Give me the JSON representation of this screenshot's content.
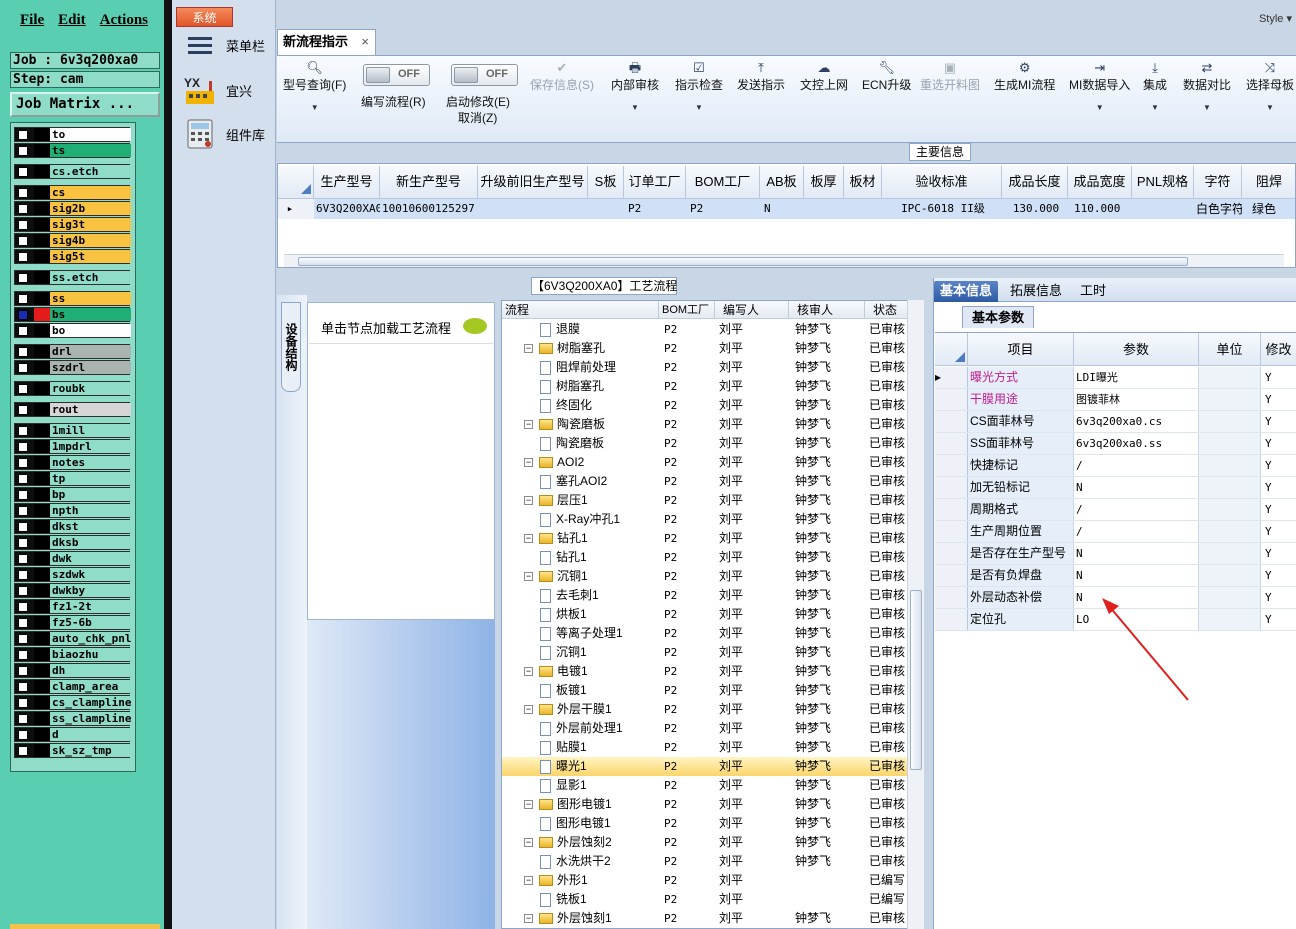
{
  "cam": {
    "menu": [
      "File",
      "Edit",
      "Actions"
    ],
    "job_line": "Job : 6v3q200xa0",
    "step_line": "Step: cam",
    "matrix_button": "Job Matrix ...",
    "layers": [
      {
        "name": "to",
        "color": "#ffffff"
      },
      {
        "name": "ts",
        "color": "#1fae73"
      },
      {
        "name": "cs.etch",
        "color": "#8fdcc8"
      },
      {
        "name": "cs",
        "color": "#f9c342"
      },
      {
        "name": "sig2b",
        "color": "#f9c342"
      },
      {
        "name": "sig3t",
        "color": "#f9c342"
      },
      {
        "name": "sig4b",
        "color": "#f9c342"
      },
      {
        "name": "sig5t",
        "color": "#f9c342"
      },
      {
        "name": "ss.etch",
        "color": "#8fdcc8"
      },
      {
        "name": "ss",
        "color": "#f9c342"
      },
      {
        "name": "bs",
        "color": "#1fae73"
      },
      {
        "name": "bo",
        "color": "#ffffff"
      },
      {
        "name": "drl",
        "color": "#a9b4b0"
      },
      {
        "name": "szdrl",
        "color": "#a9b4b0"
      },
      {
        "name": "roubk",
        "color": "#8fdcc8"
      },
      {
        "name": "rout",
        "color": "#d6d6d6"
      },
      {
        "name": "1mill",
        "color": "#8fdcc8"
      },
      {
        "name": "1mpdrl",
        "color": "#8fdcc8"
      },
      {
        "name": "notes",
        "color": "#8fdcc8"
      },
      {
        "name": "tp",
        "color": "#8fdcc8"
      },
      {
        "name": "bp",
        "color": "#8fdcc8"
      },
      {
        "name": "npth",
        "color": "#8fdcc8"
      },
      {
        "name": "dkst",
        "color": "#8fdcc8"
      },
      {
        "name": "dksb",
        "color": "#8fdcc8"
      },
      {
        "name": "dwk",
        "color": "#8fdcc8"
      },
      {
        "name": "szdwk",
        "color": "#8fdcc8"
      },
      {
        "name": "dwkby",
        "color": "#8fdcc8"
      },
      {
        "name": "fz1-2t",
        "color": "#8fdcc8"
      },
      {
        "name": "fz5-6b",
        "color": "#8fdcc8"
      },
      {
        "name": "auto_chk_pnl",
        "color": "#8fdcc8"
      },
      {
        "name": "biaozhu",
        "color": "#8fdcc8"
      },
      {
        "name": "dh",
        "color": "#8fdcc8"
      },
      {
        "name": "clamp_area",
        "color": "#8fdcc8"
      },
      {
        "name": "cs_clampline",
        "color": "#8fdcc8"
      },
      {
        "name": "ss_clampline",
        "color": "#8fdcc8"
      },
      {
        "name": "d",
        "color": "#8fdcc8"
      },
      {
        "name": "sk_sz_tmp",
        "color": "#8fdcc8"
      }
    ]
  },
  "nav": {
    "system_tab": "系统",
    "items": [
      {
        "label": "菜单栏",
        "icon": "hamburger-icon"
      },
      {
        "label": "宜兴",
        "icon": "factory-logo-icon"
      },
      {
        "label": "组件库",
        "icon": "calculator-icon"
      }
    ]
  },
  "window": {
    "style_label": "Style ▾",
    "doc_tab": "新流程指示",
    "doc_tab_close": "×"
  },
  "ribbon": {
    "query": {
      "label": "型号查询(F)",
      "icon": "search-icon"
    },
    "toggle1": {
      "state": "OFF",
      "label": "编写流程(R)"
    },
    "toggle2": {
      "state": "OFF",
      "label": "启动修改(E)"
    },
    "cancel_label": "取消(Z)",
    "buttons": [
      {
        "label": "保存信息(S)",
        "icon": "check-icon",
        "disabled": true
      },
      {
        "label": "内部审核",
        "icon": "print-icon"
      },
      {
        "label": "指示检查",
        "icon": "checkbox-icon"
      },
      {
        "label": "发送指示",
        "icon": "upload-icon"
      },
      {
        "label": "文控上网",
        "icon": "cloud-upload-icon"
      },
      {
        "label": "ECN升级",
        "icon": "wrench-icon"
      },
      {
        "label": "重选开料图",
        "icon": "image-icon",
        "disabled": true
      },
      {
        "label": "生成MI流程",
        "icon": "gears-icon"
      },
      {
        "label": "MI数据导入",
        "icon": "import-icon"
      },
      {
        "label": "集成",
        "icon": "download-icon"
      },
      {
        "label": "数据对比",
        "icon": "compare-icon"
      },
      {
        "label": "选择母板",
        "icon": "shuffle-icon"
      }
    ]
  },
  "main_info": {
    "title": "主要信息",
    "columns": [
      "生产型号",
      "新生产型号",
      "升级前旧生产型号",
      "S板",
      "订单工厂",
      "BOM工厂",
      "AB板",
      "板厚",
      "板材",
      "验收标准",
      "成品长度",
      "成品宽度",
      "PNL规格",
      "字符",
      "阻焊"
    ],
    "row": [
      "6V3Q200XA0",
      "10010600125297",
      "",
      "",
      "P2",
      "P2",
      "N",
      "",
      "",
      "IPC-6018 II级",
      "130.000",
      "110.000",
      "",
      "白色字符",
      "绿色"
    ]
  },
  "flow": {
    "title": "【6V3Q200XA0】工艺流程",
    "side_tab": "设备结构",
    "load_hint": "单击节点加载工艺流程",
    "columns": [
      "流程",
      "BOM工厂",
      "编写人",
      "核审人",
      "状态"
    ],
    "rows": [
      {
        "name": "退膜",
        "level": 1,
        "factory": "P2",
        "writer": "刘平",
        "reviewer": "钟梦飞",
        "status": "已审核"
      },
      {
        "name": "树脂塞孔",
        "level": 0,
        "factory": "P2",
        "writer": "刘平",
        "reviewer": "钟梦飞",
        "status": "已审核"
      },
      {
        "name": "阻焊前处理",
        "level": 1,
        "factory": "P2",
        "writer": "刘平",
        "reviewer": "钟梦飞",
        "status": "已审核"
      },
      {
        "name": "树脂塞孔",
        "level": 1,
        "factory": "P2",
        "writer": "刘平",
        "reviewer": "钟梦飞",
        "status": "已审核"
      },
      {
        "name": "终固化",
        "level": 1,
        "factory": "P2",
        "writer": "刘平",
        "reviewer": "钟梦飞",
        "status": "已审核"
      },
      {
        "name": "陶瓷磨板",
        "level": 0,
        "factory": "P2",
        "writer": "刘平",
        "reviewer": "钟梦飞",
        "status": "已审核"
      },
      {
        "name": "陶瓷磨板",
        "level": 1,
        "factory": "P2",
        "writer": "刘平",
        "reviewer": "钟梦飞",
        "status": "已审核"
      },
      {
        "name": "AOI2",
        "level": 0,
        "factory": "P2",
        "writer": "刘平",
        "reviewer": "钟梦飞",
        "status": "已审核"
      },
      {
        "name": "塞孔AOI2",
        "level": 1,
        "factory": "P2",
        "writer": "刘平",
        "reviewer": "钟梦飞",
        "status": "已审核"
      },
      {
        "name": "层压1",
        "level": 0,
        "factory": "P2",
        "writer": "刘平",
        "reviewer": "钟梦飞",
        "status": "已审核"
      },
      {
        "name": "X-Ray冲孔1",
        "level": 1,
        "factory": "P2",
        "writer": "刘平",
        "reviewer": "钟梦飞",
        "status": "已审核"
      },
      {
        "name": "钻孔1",
        "level": 0,
        "factory": "P2",
        "writer": "刘平",
        "reviewer": "钟梦飞",
        "status": "已审核"
      },
      {
        "name": "钻孔1",
        "level": 1,
        "factory": "P2",
        "writer": "刘平",
        "reviewer": "钟梦飞",
        "status": "已审核"
      },
      {
        "name": "沉铜1",
        "level": 0,
        "factory": "P2",
        "writer": "刘平",
        "reviewer": "钟梦飞",
        "status": "已审核"
      },
      {
        "name": "去毛刺1",
        "level": 1,
        "factory": "P2",
        "writer": "刘平",
        "reviewer": "钟梦飞",
        "status": "已审核"
      },
      {
        "name": "烘板1",
        "level": 1,
        "factory": "P2",
        "writer": "刘平",
        "reviewer": "钟梦飞",
        "status": "已审核"
      },
      {
        "name": "等离子处理1",
        "level": 1,
        "factory": "P2",
        "writer": "刘平",
        "reviewer": "钟梦飞",
        "status": "已审核"
      },
      {
        "name": "沉铜1",
        "level": 1,
        "factory": "P2",
        "writer": "刘平",
        "reviewer": "钟梦飞",
        "status": "已审核"
      },
      {
        "name": "电镀1",
        "level": 0,
        "factory": "P2",
        "writer": "刘平",
        "reviewer": "钟梦飞",
        "status": "已审核"
      },
      {
        "name": "板镀1",
        "level": 1,
        "factory": "P2",
        "writer": "刘平",
        "reviewer": "钟梦飞",
        "status": "已审核"
      },
      {
        "name": "外层干膜1",
        "level": 0,
        "factory": "P2",
        "writer": "刘平",
        "reviewer": "钟梦飞",
        "status": "已审核"
      },
      {
        "name": "外层前处理1",
        "level": 1,
        "factory": "P2",
        "writer": "刘平",
        "reviewer": "钟梦飞",
        "status": "已审核"
      },
      {
        "name": "贴膜1",
        "level": 1,
        "factory": "P2",
        "writer": "刘平",
        "reviewer": "钟梦飞",
        "status": "已审核"
      },
      {
        "name": "曝光1",
        "level": 1,
        "factory": "P2",
        "writer": "刘平",
        "reviewer": "钟梦飞",
        "status": "已审核",
        "selected": true
      },
      {
        "name": "显影1",
        "level": 1,
        "factory": "P2",
        "writer": "刘平",
        "reviewer": "钟梦飞",
        "status": "已审核"
      },
      {
        "name": "图形电镀1",
        "level": 0,
        "factory": "P2",
        "writer": "刘平",
        "reviewer": "钟梦飞",
        "status": "已审核"
      },
      {
        "name": "图形电镀1",
        "level": 1,
        "factory": "P2",
        "writer": "刘平",
        "reviewer": "钟梦飞",
        "status": "已审核"
      },
      {
        "name": "外层蚀刻2",
        "level": 0,
        "factory": "P2",
        "writer": "刘平",
        "reviewer": "钟梦飞",
        "status": "已审核"
      },
      {
        "name": "水洗烘干2",
        "level": 1,
        "factory": "P2",
        "writer": "刘平",
        "reviewer": "钟梦飞",
        "status": "已审核"
      },
      {
        "name": "外形1",
        "level": 0,
        "factory": "P2",
        "writer": "刘平",
        "reviewer": "",
        "status": "已编写"
      },
      {
        "name": "铣板1",
        "level": 1,
        "factory": "P2",
        "writer": "刘平",
        "reviewer": "",
        "status": "已编写"
      },
      {
        "name": "外层蚀刻1",
        "level": 0,
        "factory": "P2",
        "writer": "刘平",
        "reviewer": "钟梦飞",
        "status": "已审核"
      }
    ]
  },
  "detail": {
    "tabs": [
      "基本信息",
      "拓展信息",
      "工时"
    ],
    "subtab": "基本参数",
    "columns": [
      "项目",
      "参数",
      "单位",
      "修改"
    ],
    "rows": [
      {
        "item": "曝光方式",
        "value": "LDI曝光",
        "unit": "",
        "mod": "Y",
        "highlight": true
      },
      {
        "item": "干膜用途",
        "value": "图镀菲林",
        "unit": "",
        "mod": "Y",
        "highlight": true
      },
      {
        "item": "CS面菲林号",
        "value": "6v3q200xa0.cs",
        "unit": "",
        "mod": "Y"
      },
      {
        "item": "SS面菲林号",
        "value": "6v3q200xa0.ss",
        "unit": "",
        "mod": "Y"
      },
      {
        "item": "快捷标记",
        "value": "/",
        "unit": "",
        "mod": "Y"
      },
      {
        "item": "加无铅标记",
        "value": "N",
        "unit": "",
        "mod": "Y"
      },
      {
        "item": "周期格式",
        "value": "/",
        "unit": "",
        "mod": "Y"
      },
      {
        "item": "生产周期位置",
        "value": "/",
        "unit": "",
        "mod": "Y"
      },
      {
        "item": "是否存在生产型号",
        "value": "N",
        "unit": "",
        "mod": "Y"
      },
      {
        "item": "是否有负焊盘",
        "value": "N",
        "unit": "",
        "mod": "Y"
      },
      {
        "item": "外层动态补偿",
        "value": "N",
        "unit": "",
        "mod": "Y"
      },
      {
        "item": "定位孔",
        "value": "LO",
        "unit": "",
        "mod": "Y"
      }
    ]
  },
  "colors": {
    "annotation_arrow": "#e0201c",
    "selected_row": "#fbd56a",
    "highlight_text": "#c21c8c"
  }
}
